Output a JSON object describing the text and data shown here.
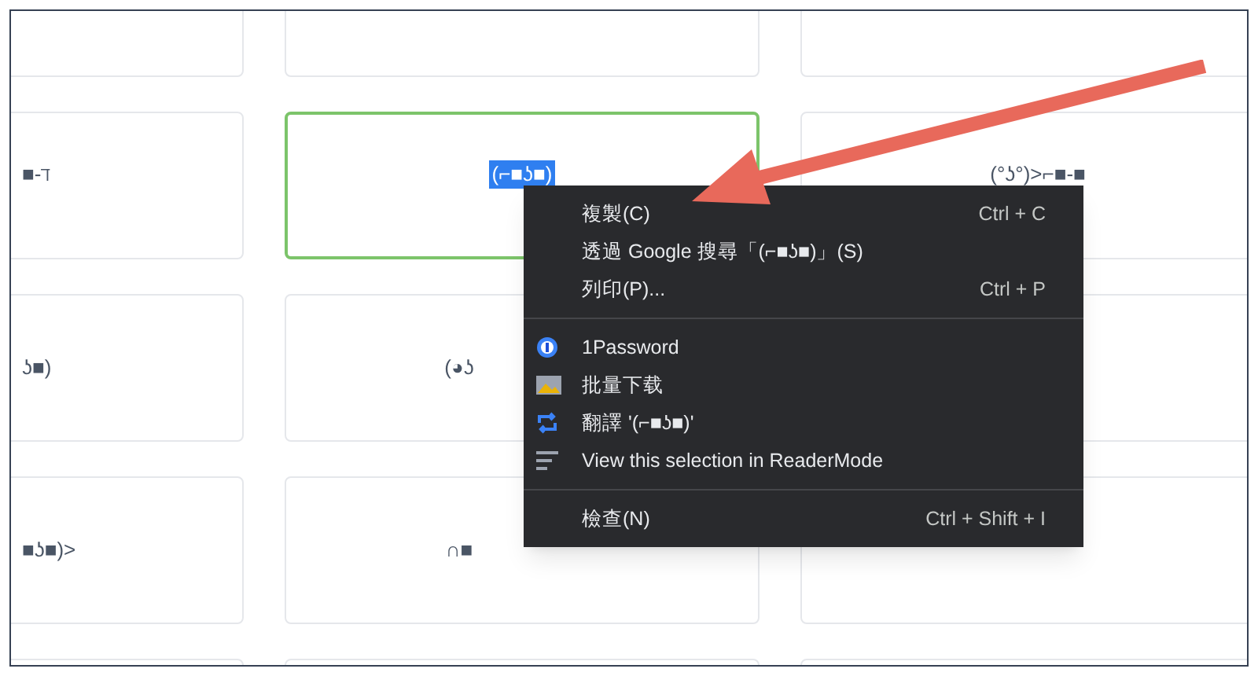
{
  "grid": {
    "rows": [
      [
        {
          "text": "■-ℸ",
          "selected": false
        },
        {
          "text": "(⌐■ʖ■)",
          "selected": true
        },
        {
          "text": "(°ʖ°)>⌐■-■",
          "selected": false
        }
      ],
      [
        {
          "text": "ʖ■)",
          "selected": false
        },
        {
          "text": "(◕ʖ",
          "selected": false
        },
        {
          "selected": false
        }
      ],
      [
        {
          "text": "■ʖ■)>",
          "selected": false
        },
        {
          "text": "∩■",
          "selected": false
        },
        {
          "selected": false
        }
      ]
    ]
  },
  "context_menu": {
    "groups": [
      [
        {
          "kind": "plain",
          "label": "複製(C)",
          "shortcut": "Ctrl + C"
        },
        {
          "kind": "plain",
          "label": "透過 Google 搜尋「(⌐■ʖ■)」(S)"
        },
        {
          "kind": "plain",
          "label": "列印(P)...",
          "shortcut": "Ctrl + P"
        }
      ],
      [
        {
          "kind": "extension",
          "label": "1Password"
        },
        {
          "kind": "extension",
          "label": "批量下载"
        },
        {
          "kind": "extension",
          "label": "翻譯 '(⌐■ʖ■)'"
        },
        {
          "kind": "extension",
          "label": "View this selection in ReaderMode"
        }
      ],
      [
        {
          "kind": "plain",
          "label": "檢查(N)",
          "shortcut": "Ctrl + Shift + I"
        }
      ]
    ]
  }
}
